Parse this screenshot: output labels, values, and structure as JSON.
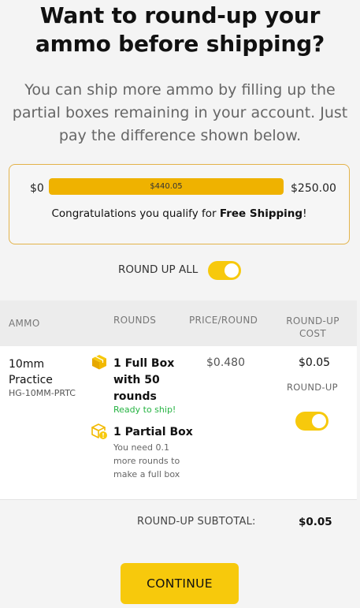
{
  "header": {
    "title": "Want to round-up your ammo before shipping?",
    "subtitle": "You can ship more ammo by filling up the partial boxes remaining in your account. Just pay the difference shown below."
  },
  "shipping": {
    "min_label": "$0",
    "max_label": "$250.00",
    "current_label": "$440.05",
    "progress_fraction": 1.0,
    "message_prefix": "Congratulations you qualify for ",
    "message_bold": "Free Shipping",
    "message_suffix": "!"
  },
  "round_up_all": {
    "label": "ROUND UP ALL",
    "enabled": true
  },
  "table": {
    "headers": {
      "ammo": "AMMO",
      "rounds": "ROUNDS",
      "price": "PRICE/ROUND",
      "cost": "ROUND-UP COST"
    },
    "rows": [
      {
        "ammo_name": "10mm Practice",
        "ammo_sku": "HG-10MM-PRTC",
        "full_box": "1 Full Box with 50 rounds",
        "full_status": "Ready to ship!",
        "partial_box": "1 Partial Box",
        "partial_note": "You need 0.1 more rounds to make a full box",
        "price_per_round": "$0.480",
        "round_up_cost": "$0.05",
        "round_up_label": "ROUND-UP",
        "round_up_enabled": true
      }
    ]
  },
  "subtotal": {
    "label": "ROUND-UP SUBTOTAL:",
    "value": "$0.05"
  },
  "continue_label": "CONTINUE",
  "colors": {
    "accent": "#f7c90c",
    "bar_fill": "#efb200",
    "ready": "#25b342",
    "ship_border": "#e3b34a"
  }
}
